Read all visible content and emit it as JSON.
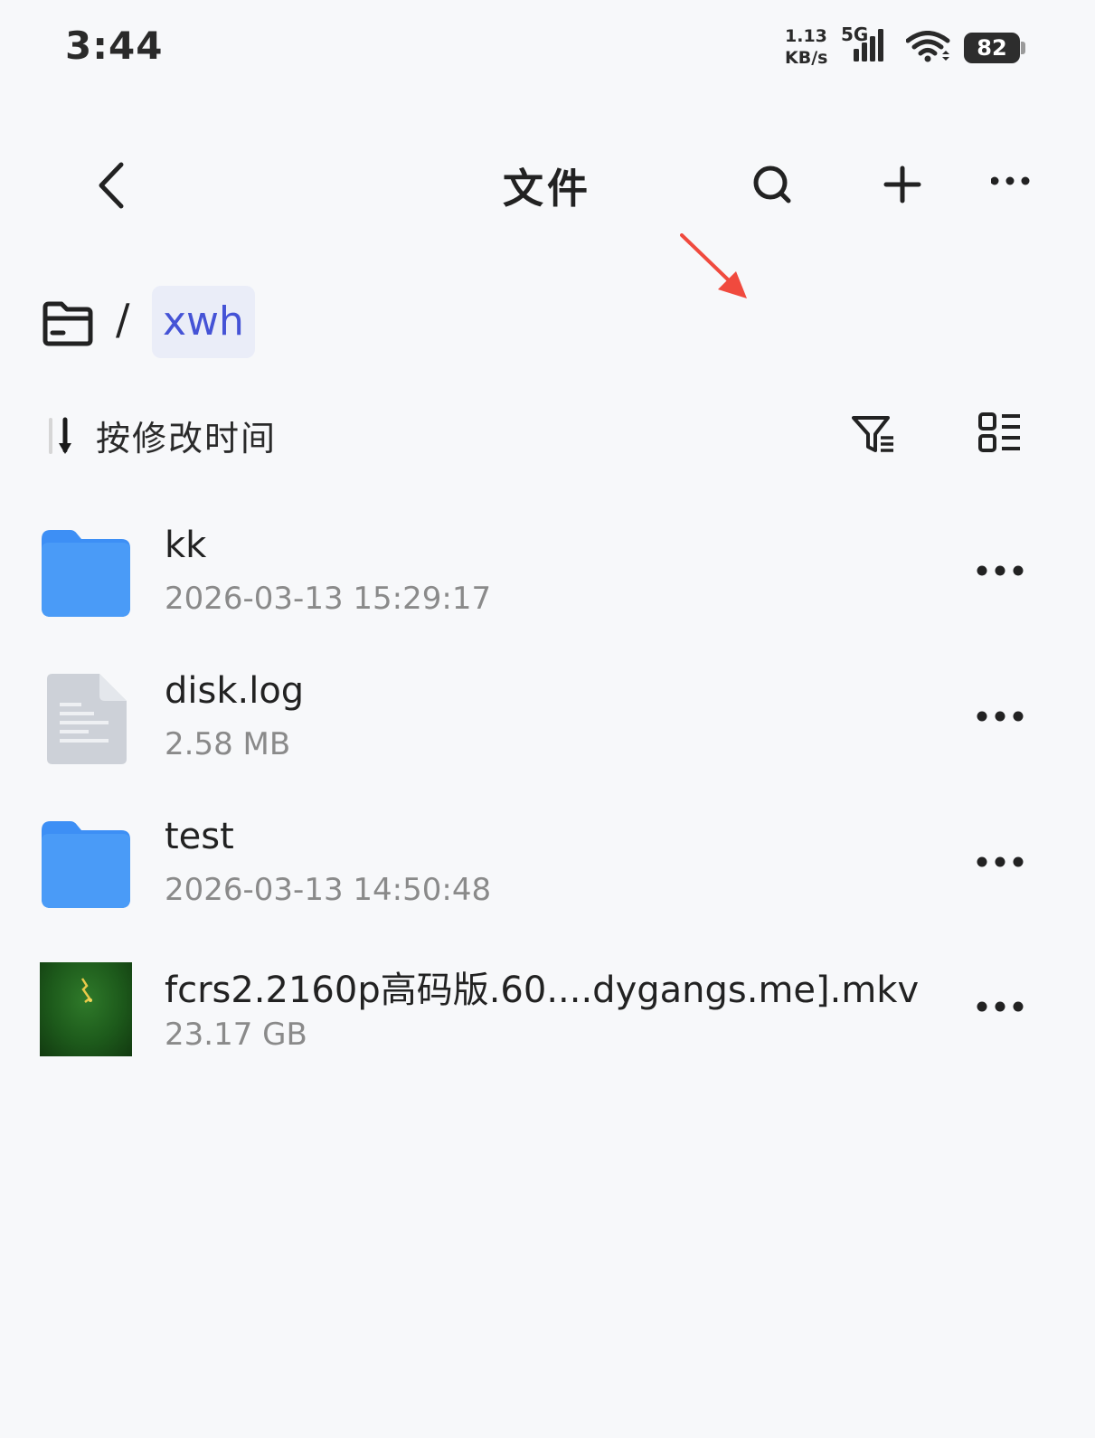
{
  "status_bar": {
    "time": "3:44",
    "net_speed_value": "1.13",
    "net_speed_unit": "KB/s",
    "network_type": "5G",
    "battery_level": "82",
    "signal_icon": "cellular-signal-icon",
    "wifi_icon": "wifi-icon"
  },
  "header": {
    "title": "文件",
    "back_icon": "chevron-left-icon",
    "search_icon": "search-icon",
    "add_icon": "plus-icon",
    "more_icon": "more-horizontal-icon"
  },
  "breadcrumb": {
    "root_icon": "folder-outline-icon",
    "separator": "/",
    "current": "xwh"
  },
  "toolbar": {
    "sort_label": "按修改时间",
    "sort_icon": "sort-descending-icon",
    "filter_icon": "filter-list-icon",
    "view_toggle_icon": "list-view-icon"
  },
  "files": [
    {
      "name": "kk",
      "meta": "2026-03-13 15:29:17",
      "type": "folder"
    },
    {
      "name": "disk.log",
      "meta": "2.58 MB",
      "type": "document"
    },
    {
      "name": "test",
      "meta": "2026-03-13 14:50:48",
      "type": "folder"
    },
    {
      "name": "fcrs2.2160p高码版.60....dygangs.me].mkv",
      "meta": "23.17 GB",
      "type": "video"
    }
  ],
  "colors": {
    "background": "#f7f8fa",
    "accent": "#4553d6",
    "folder_blue": "#3d8ff5",
    "annotation_red": "#f04a3e"
  }
}
